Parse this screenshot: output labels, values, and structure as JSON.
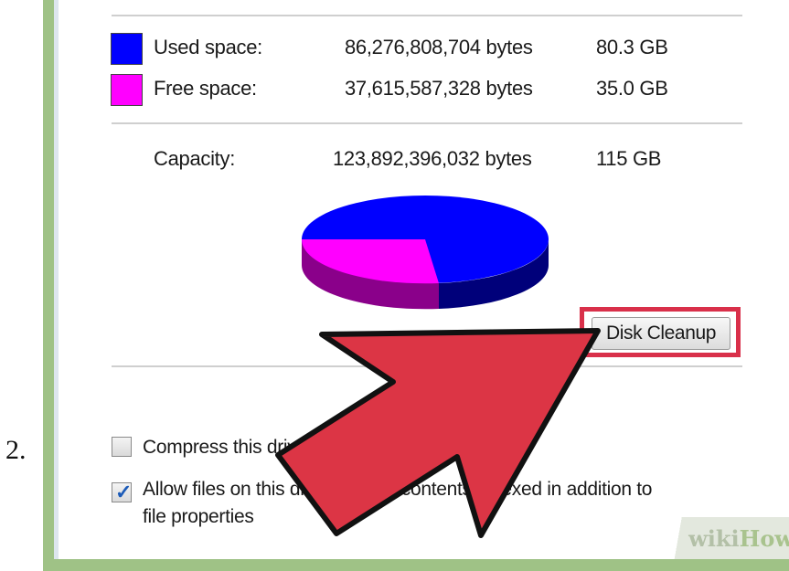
{
  "step_number": "2.",
  "drive_stats": {
    "used": {
      "label": "Used space:",
      "bytes": "86,276,808,704 bytes",
      "size": "80.3 GB",
      "color": "#0000ff"
    },
    "free": {
      "label": "Free space:",
      "bytes": "37,615,587,328 bytes",
      "size": "35.0 GB",
      "color": "#ff00ff"
    },
    "capacity": {
      "label": "Capacity:",
      "bytes": "123,892,396,032 bytes",
      "size": "115 GB"
    }
  },
  "pie": {
    "used_fraction": 0.697,
    "free_fraction": 0.303
  },
  "disk_cleanup_button": {
    "label": "Disk Cleanup"
  },
  "options": {
    "compress": {
      "label": "Compress this drive to save disk space",
      "checked": false
    },
    "index": {
      "label": "Allow files on this drive to have contents indexed in addition to",
      "label_line2": "file properties",
      "checked": true
    }
  },
  "watermark": {
    "wiki": "wiki",
    "how": "How"
  },
  "colors": {
    "highlight": "#d9304a",
    "arrow": "#dc3545",
    "frame": "#9fc286"
  }
}
